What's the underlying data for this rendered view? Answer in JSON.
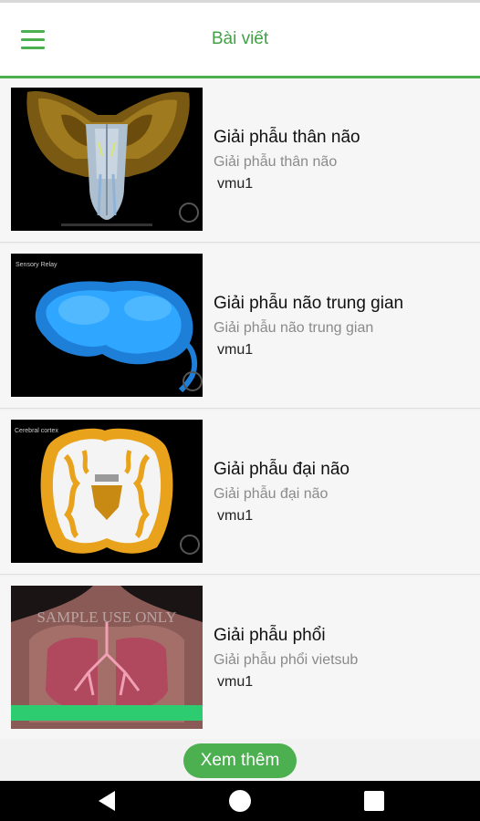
{
  "header": {
    "title": "Bài viết",
    "menu_icon": "hamburger-menu-icon"
  },
  "articles": [
    {
      "title": "Giải phẫu thân não",
      "subtitle": "Giải phẫu thân não",
      "author": "vmu1",
      "thumb_caption": ""
    },
    {
      "title": "Giải phẫu não trung gian",
      "subtitle": "Giải phẫu não trung gian",
      "author": "vmu1",
      "thumb_caption": "Sensory Relay"
    },
    {
      "title": "Giải phẫu đại não",
      "subtitle": "Giải phẫu đại não",
      "author": "vmu1",
      "thumb_caption": "Cerebral cortex"
    },
    {
      "title": "Giải phẫu phổi",
      "subtitle": "Giải phẫu phổi vietsub",
      "author": "vmu1",
      "thumb_caption": "SAMPLE USE ONLY"
    }
  ],
  "footer": {
    "more_label": "Xem thêm"
  },
  "system_nav": {
    "back_icon": "back-triangle-icon",
    "home_icon": "home-circle-icon",
    "recents_icon": "recents-square-icon"
  },
  "colors": {
    "accent": "#4caf50",
    "title_green": "#43a047"
  }
}
